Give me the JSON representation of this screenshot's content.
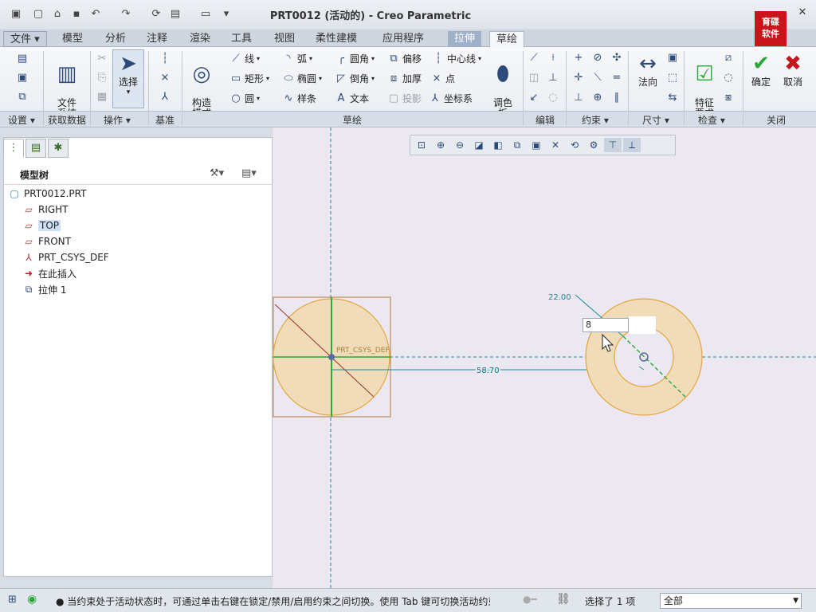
{
  "window": {
    "title": "PRT0012 (活动的) - Creo Parametric"
  },
  "logo": {
    "line1": "育碟",
    "line2": "软件"
  },
  "quick_access": [
    "app-icon",
    "new-icon",
    "open-icon",
    "save-icon",
    "undo-icon",
    "redo-icon",
    "regenerate-icon",
    "windows-icon",
    "close-window-icon",
    "customize-icon"
  ],
  "tabs": [
    {
      "label": "文件 ▾"
    },
    {
      "label": "模型"
    },
    {
      "label": "分析"
    },
    {
      "label": "注释"
    },
    {
      "label": "渲染"
    },
    {
      "label": "工具"
    },
    {
      "label": "视图"
    },
    {
      "label": "柔性建模"
    },
    {
      "label": "应用程序"
    },
    {
      "label": "拉伸"
    },
    {
      "label": "草绘"
    }
  ],
  "ribbon": {
    "file_system": "文件\n系统",
    "select": "选择",
    "construct_mode": "构造\n模式",
    "sketch": {
      "line": "线",
      "arc": "弧",
      "fillet": "圆角",
      "offset": "偏移",
      "centerline": "中心线",
      "rectangle": "矩形",
      "ellipse": "椭圆",
      "chamfer": "倒角",
      "thicken": "加厚",
      "point": "点",
      "circle": "圆",
      "spline": "样条",
      "text": "文本",
      "project": "投影",
      "coordinate_system": "坐标系"
    },
    "palette": "调色\n板",
    "normal": "法向",
    "feature_requirements": "特征\n要求",
    "ok": "确定",
    "cancel": "取消"
  },
  "groups": {
    "setup": "设置 ▾",
    "get_data": "获取数据",
    "operations": "操作 ▾",
    "datum": "基准",
    "sketching": "草绘",
    "editing": "编辑",
    "constrain": "约束 ▾",
    "dimension": "尺寸 ▾",
    "inspect": "检查 ▾",
    "close": "关闭"
  },
  "model_tree": {
    "title": "模型树",
    "items": [
      {
        "label": "PRT0012.PRT",
        "icon": "part-icon"
      },
      {
        "label": "RIGHT",
        "icon": "datum-plane-icon"
      },
      {
        "label": "TOP",
        "icon": "datum-plane-icon"
      },
      {
        "label": "FRONT",
        "icon": "datum-plane-icon"
      },
      {
        "label": "PRT_CSYS_DEF",
        "icon": "csys-icon"
      },
      {
        "label": "在此插入",
        "icon": "insert-arrow-icon"
      },
      {
        "label": "拉伸 1",
        "icon": "extrude-icon"
      }
    ]
  },
  "canvas": {
    "csys_label": "PRT_CSYS_DEF",
    "dim_distance": "58.70",
    "dim_diameter": "22.00",
    "dim_input_value": "8",
    "colors": {
      "fill": "#f0dcb9",
      "edge": "#e3a53c",
      "dim": "#1a8a9a",
      "green": "#2aa83a"
    }
  },
  "status": {
    "message": "● 当约束处于活动状态时，可通过单击右键在锁定/禁用/启用约束之间切换。使用 Tab 键可切换活动约束。按住",
    "selected": "选择了 1 项",
    "filter": "全部"
  }
}
